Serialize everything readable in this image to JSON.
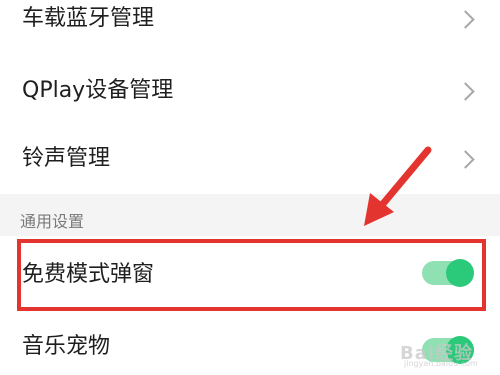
{
  "rows": [
    {
      "label": "车载蓝牙管理",
      "control": "chevron"
    },
    {
      "label": "QPlay设备管理",
      "control": "chevron"
    },
    {
      "label": "铃声管理",
      "control": "chevron"
    }
  ],
  "section": {
    "title": "通用设置"
  },
  "toggles": [
    {
      "label": "免费模式弹窗",
      "state": "on"
    },
    {
      "label": "音乐宠物",
      "state": "on"
    }
  ],
  "watermark": {
    "text": "Bai经验",
    "sub": "jingyan.baidu.com"
  },
  "colors": {
    "highlight": "#e3342f",
    "toggle_on": "#2bc97a",
    "section_bg": "#f4f4f4"
  }
}
